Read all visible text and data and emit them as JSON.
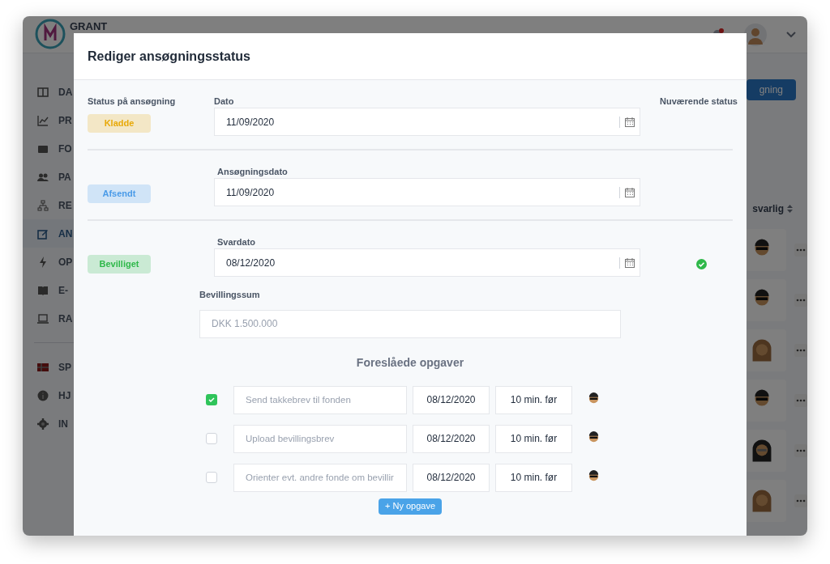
{
  "app": {
    "logo_text": "GRANT",
    "sidebar": [
      {
        "label": "DA",
        "selected": false
      },
      {
        "label": "PR",
        "selected": false
      },
      {
        "label": "FO",
        "selected": false
      },
      {
        "label": "PA",
        "selected": false
      },
      {
        "label": "RE",
        "selected": false
      },
      {
        "label": "AN",
        "selected": true
      },
      {
        "label": "OP",
        "selected": false
      },
      {
        "label": "E-",
        "selected": false
      },
      {
        "label": "RA",
        "selected": false
      },
      {
        "label": "SP",
        "selected": false
      },
      {
        "label": "HJ",
        "selected": false
      },
      {
        "label": "IN",
        "selected": false
      }
    ],
    "header_button": "gning",
    "column_header": "svarlig",
    "rows": [
      {
        "kind": "man"
      },
      {
        "kind": "man"
      },
      {
        "kind": "woman"
      },
      {
        "kind": "man"
      },
      {
        "kind": "woman-glasses"
      },
      {
        "kind": "woman"
      }
    ]
  },
  "modal": {
    "title": "Rediger ansøgningsstatus",
    "status_header": "Status på ansøgning",
    "current_header": "Nuværende status",
    "statuses": [
      {
        "badge": "Kladde",
        "color": "#e8a908",
        "field_label": "Dato",
        "date": "11/09/2020",
        "current": false
      },
      {
        "badge": "Afsendt",
        "color": "#4a9be8",
        "field_label": "Ansøgningsdato",
        "date": "11/09/2020",
        "current": false
      },
      {
        "badge": "Bevilliget",
        "color": "#2fb84a",
        "field_label": "Svardato",
        "date": "08/12/2020",
        "current": true
      }
    ],
    "amount_label": "Bevillingssum",
    "amount_placeholder": "DKK 1.500.000",
    "tasks_title": "Foreslåede opgaver",
    "tasks": [
      {
        "checked": true,
        "placeholder": "Send takkebrev til fonden",
        "date": "08/12/2020",
        "reminder": "10 min. før"
      },
      {
        "checked": false,
        "placeholder": "Upload bevillingsbrev",
        "date": "08/12/2020",
        "reminder": "10 min. før"
      },
      {
        "checked": false,
        "placeholder": "Orienter evt. andre fonde om bevillir",
        "date": "08/12/2020",
        "reminder": "10 min. før"
      }
    ],
    "new_task_button": "+ Ny opgave"
  }
}
